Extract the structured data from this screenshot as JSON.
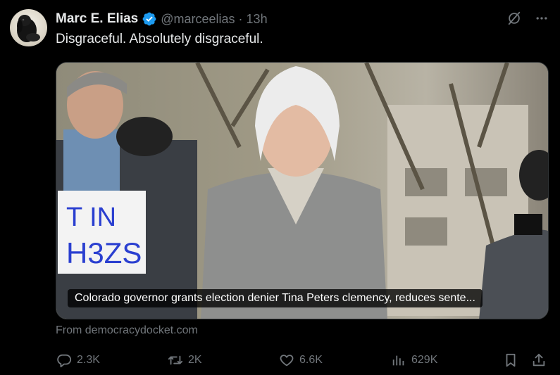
{
  "tweet": {
    "author_name": "Marc E. Elias",
    "handle": "@marceelias",
    "separator": "·",
    "time": "13h",
    "text": "Disgraceful. Absolutely disgraceful.",
    "verified": true
  },
  "media": {
    "caption": "Colorado governor grants election denier Tina Peters clemency, reduces sente...",
    "sign_text_line1": "T IN",
    "sign_text_line2": "H3ZS"
  },
  "link_source": "From democracydocket.com",
  "actions": {
    "replies": "2.3K",
    "reposts": "2K",
    "likes": "6.6K",
    "views": "629K"
  },
  "icons": {
    "verified": "verified-badge-icon",
    "grok": "grok-icon",
    "more": "more-icon",
    "reply": "reply-icon",
    "repost": "repost-icon",
    "like": "heart-icon",
    "views": "views-icon",
    "bookmark": "bookmark-icon",
    "share": "share-icon"
  },
  "colors": {
    "background": "#000000",
    "text": "#e7e9ea",
    "secondary": "#71767b",
    "verified": "#1d9bf0"
  }
}
